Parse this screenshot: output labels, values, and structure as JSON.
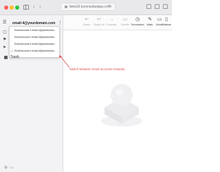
{
  "browser": {
    "url": "beta16.tuconsulasppa.com",
    "icons": [
      "sidebar-toggle-icon",
      "back-icon",
      "forward-icon",
      "lock-icon",
      "reload-icon",
      "share-icon",
      "new-tab-icon",
      "tabs-icon"
    ]
  },
  "sidebar": {
    "account_label": "email-4@yourdomain.com",
    "dropdown": {
      "items": [
        {
          "label": "Email Account 1 email-1@yourdomain...",
          "checked": false
        },
        {
          "label": "Email Account 2 email-2@yourdomain...",
          "checked": false
        },
        {
          "label": "Email Account 3 email-3@yourdomain...",
          "checked": false
        },
        {
          "label": "Email Account 4 email-4@yourdomain...",
          "checked": true
        }
      ],
      "checkmark": "✓"
    },
    "folders": [
      {
        "label": "Trash",
        "icon": "trash-icon"
      }
    ]
  },
  "toolbar": {
    "items": [
      {
        "label": "Reply",
        "icon": "reply-icon",
        "glyph": "↩",
        "active": false
      },
      {
        "label": "Reply all",
        "icon": "reply-all-icon",
        "glyph": "↩",
        "active": false
      },
      {
        "label": "Forward",
        "icon": "forward-icon",
        "glyph": "→",
        "active": false
      },
      {
        "label": "Delete",
        "icon": "delete-icon",
        "glyph": "▭",
        "active": false
      },
      {
        "label": "Scheduled",
        "icon": "scheduled-icon",
        "glyph": "◷",
        "active": true
      },
      {
        "label": "Mark",
        "icon": "mark-icon",
        "glyph": "✎",
        "active": true
      },
      {
        "label": "Move",
        "icon": "move-icon",
        "glyph": "▭",
        "active": true
      },
      {
        "label": "Sidebar",
        "icon": "sidebar-icon",
        "glyph": "▯",
        "active": true
      }
    ]
  },
  "annotation": {
    "text": "Switch between email accounts instantly",
    "color": "#e0444c"
  },
  "colors": {
    "sidebar_bg": "#f3f3f5",
    "accent_red": "#e0444c"
  }
}
